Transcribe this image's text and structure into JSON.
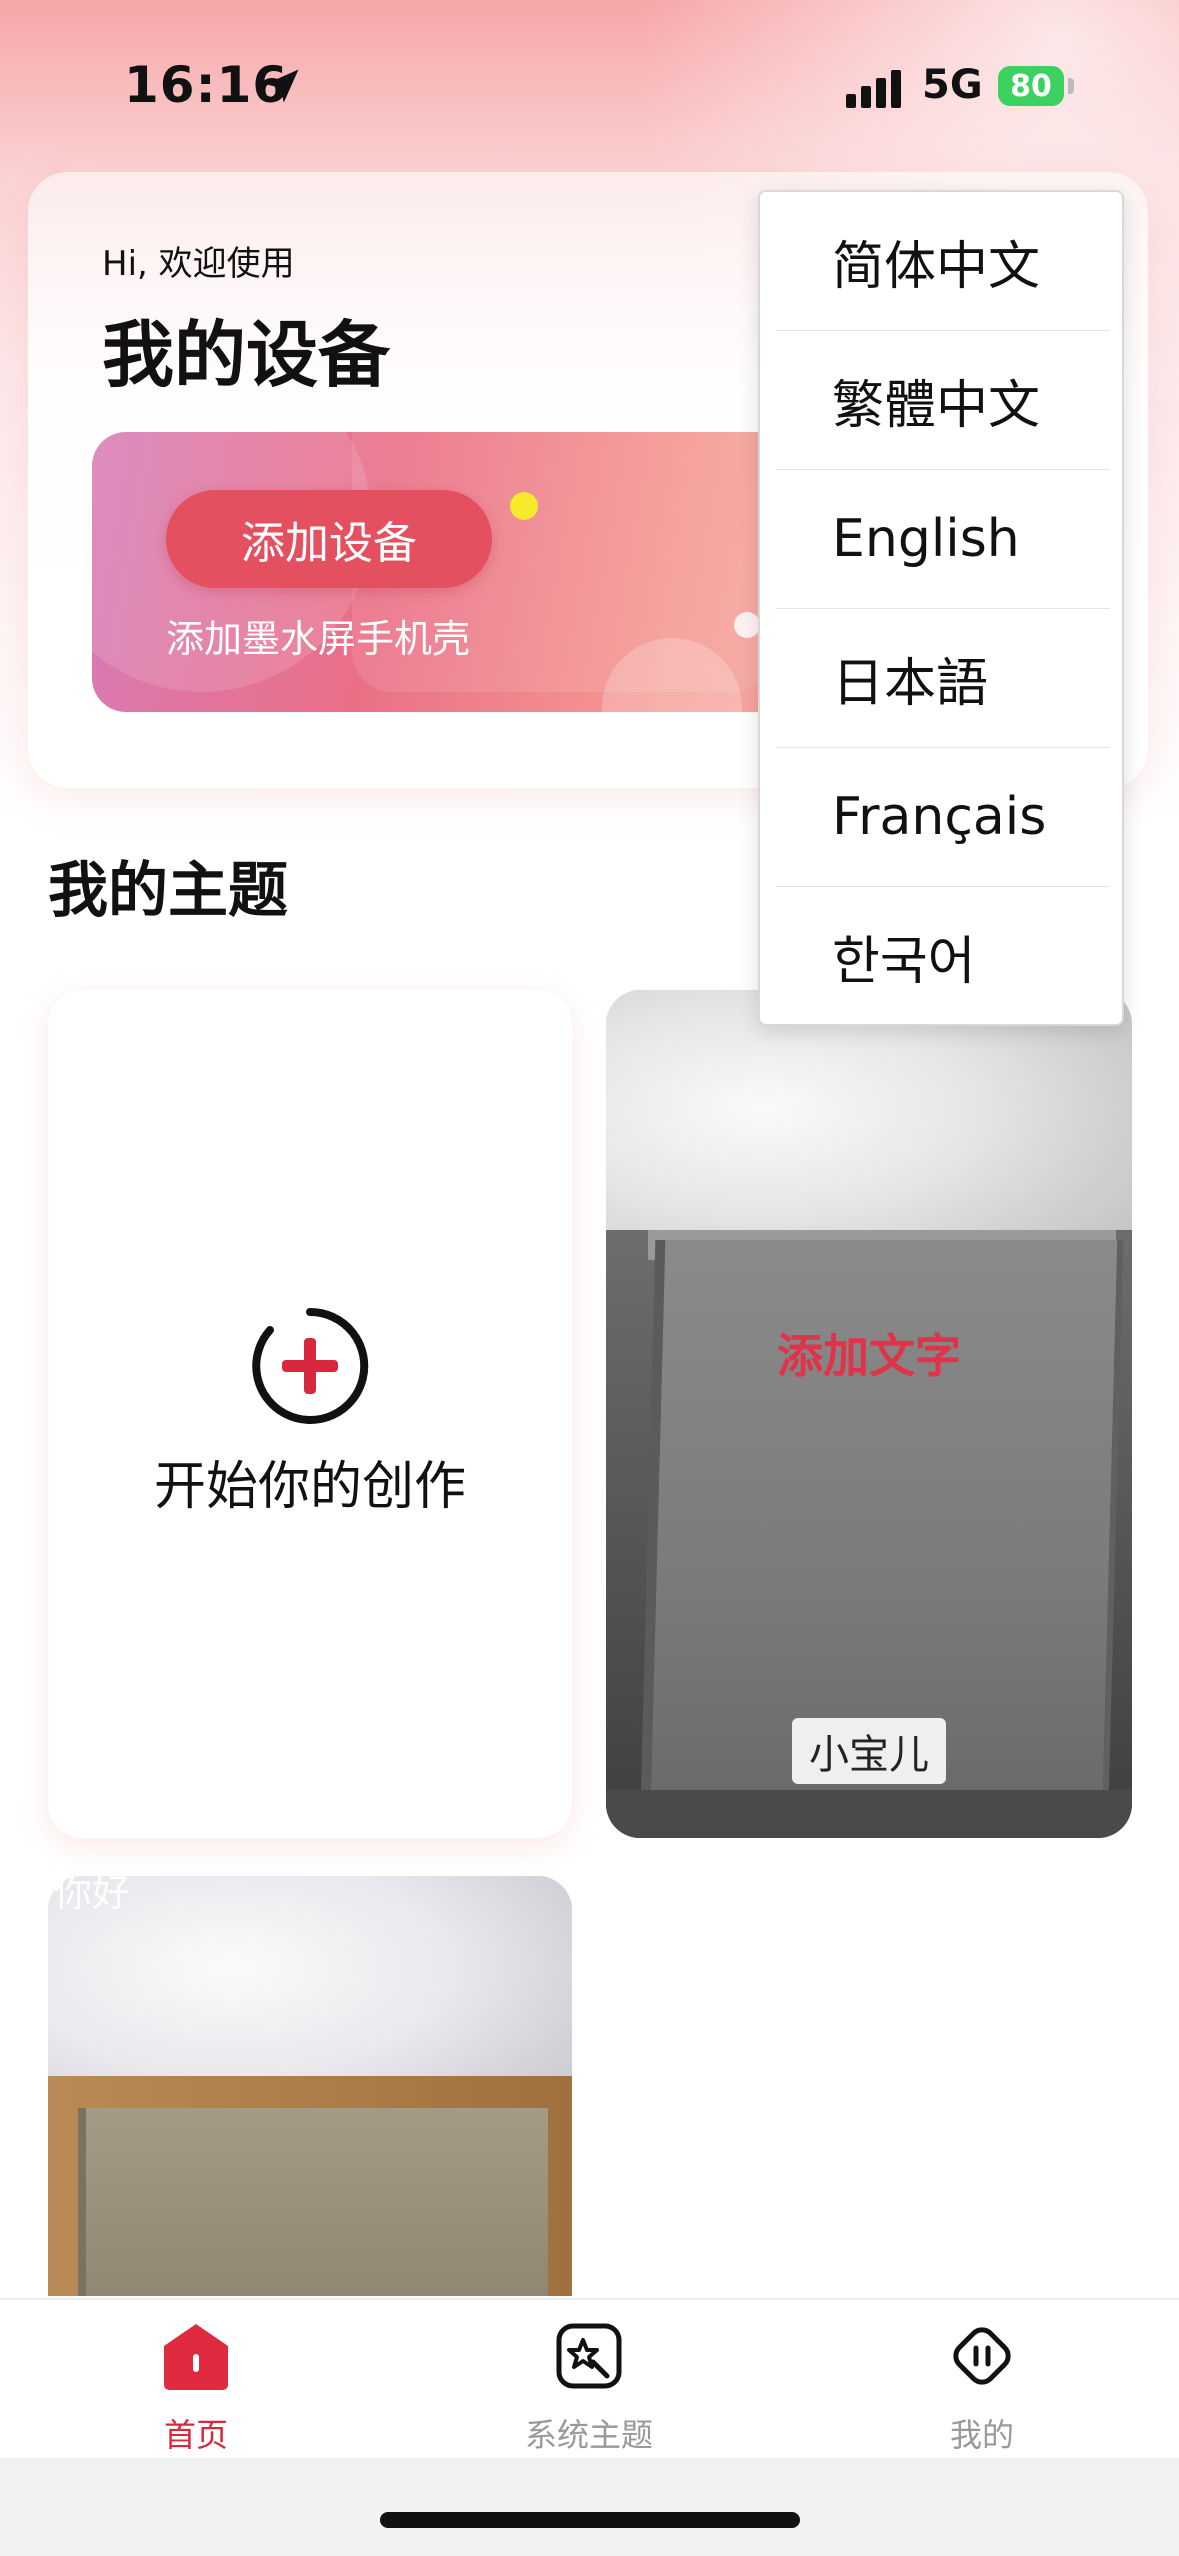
{
  "status_bar": {
    "time": "16:16",
    "network": "5G",
    "battery": "80"
  },
  "device_section": {
    "greeting": "Hi, 欢迎使用",
    "title": "我的设备",
    "add_button": "添加设备",
    "add_subtitle": "添加墨水屏手机壳"
  },
  "themes_section": {
    "title": "我的主题",
    "more_icon": "chevron-right-icon",
    "create_label": "开始你的创作",
    "cards": [
      {
        "overlay_text": "添加文字",
        "sticker_text": "小宝儿"
      },
      {
        "overlay_text": "你好"
      }
    ]
  },
  "language_menu": {
    "items": [
      "简体中文",
      "繁體中文",
      "English",
      "日本語",
      "Français",
      "한국어"
    ]
  },
  "tab_bar": {
    "tabs": [
      {
        "label": "首页",
        "icon": "home-icon",
        "active": true
      },
      {
        "label": "系统主题",
        "icon": "magic-theme-icon",
        "active": false
      },
      {
        "label": "我的",
        "icon": "profile-icon",
        "active": false
      }
    ]
  },
  "colors": {
    "accent": "#d8283e",
    "button": "#e4505f",
    "battery": "#3dd160"
  }
}
